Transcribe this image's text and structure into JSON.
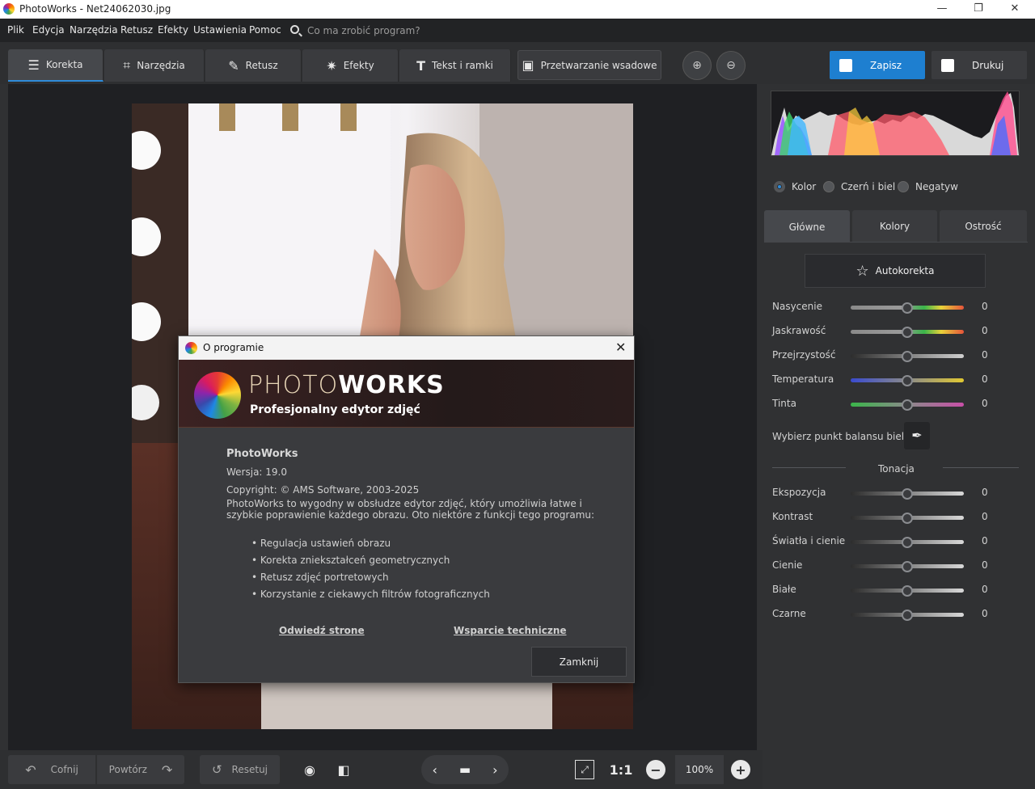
{
  "window": {
    "title": "PhotoWorks - Net24062030.jpg",
    "minimize": "—",
    "maximize": "❐",
    "close": "✕"
  },
  "menu": {
    "items": [
      "Plik",
      "Edycja",
      "Narzędzia",
      "Retusz",
      "Efekty",
      "Ustawienia",
      "Pomoc"
    ],
    "search_hint": "Co ma zrobić program?"
  },
  "tabs": [
    {
      "label": "Korekta",
      "icon": "sliders-icon",
      "glyph": "☰"
    },
    {
      "label": "Narzędzia",
      "icon": "crop-icon",
      "glyph": "⌗"
    },
    {
      "label": "Retusz",
      "icon": "brush-icon",
      "glyph": "✎"
    },
    {
      "label": "Efekty",
      "icon": "magic-wand-icon",
      "glyph": "✷"
    },
    {
      "label": "Tekst i ramki",
      "icon": "text-icon",
      "glyph": "T"
    },
    {
      "label": "Przetwarzanie wsadowe",
      "icon": "images-icon",
      "glyph": "▣"
    }
  ],
  "actions": {
    "save": "Zapisz",
    "print": "Drukuj"
  },
  "dialog": {
    "title": "O programie",
    "brand_light": "PHOTO",
    "brand_bold": "WORKS",
    "tagline": "Profesjonalny edytor zdjęć",
    "product": "PhotoWorks",
    "version": "Wersja: 19.0",
    "copyright": "Copyright: © AMS Software, 2003-2025",
    "description": "PhotoWorks to wygodny w obsłudze edytor zdjęć, który umożliwia łatwe i szybkie poprawienie każdego obrazu. Oto niektóre z funkcji tego programu:",
    "features": [
      "Regulacja ustawień obrazu",
      "Korekta zniekształceń geometrycznych",
      "Retusz zdjęć portretowych",
      "Korzystanie z ciekawych filtrów fotograficznych"
    ],
    "link_site": "Odwiedź strone",
    "link_support": "Wsparcie techniczne",
    "close": "Zamknij"
  },
  "panel": {
    "modes": [
      "Kolor",
      "Czerń i biel",
      "Negatyw"
    ],
    "selected_mode": "Kolor",
    "tabs": [
      "Główne",
      "Kolory",
      "Ostrość"
    ],
    "auto": "Autokorekta",
    "color_sliders": [
      {
        "label": "Nasycenie",
        "value": "0"
      },
      {
        "label": "Jaskrawość",
        "value": "0"
      },
      {
        "label": "Przejrzystość",
        "value": "0"
      },
      {
        "label": "Temperatura",
        "value": "0"
      },
      {
        "label": "Tinta",
        "value": "0"
      }
    ],
    "white_balance": "Wybierz punkt balansu bieli",
    "tone_header": "Tonacja",
    "tone_sliders": [
      {
        "label": "Ekspozycja",
        "value": "0"
      },
      {
        "label": "Kontrast",
        "value": "0"
      },
      {
        "label": "Światła i cienie",
        "value": "0"
      },
      {
        "label": "Cienie",
        "value": "0"
      },
      {
        "label": "Białe",
        "value": "0"
      },
      {
        "label": "Czarne",
        "value": "0"
      }
    ]
  },
  "bottom": {
    "undo": "Cofnij",
    "redo": "Powtórz",
    "reset": "Resetuj",
    "one_to_one": "1:1",
    "zoom": "100%"
  }
}
